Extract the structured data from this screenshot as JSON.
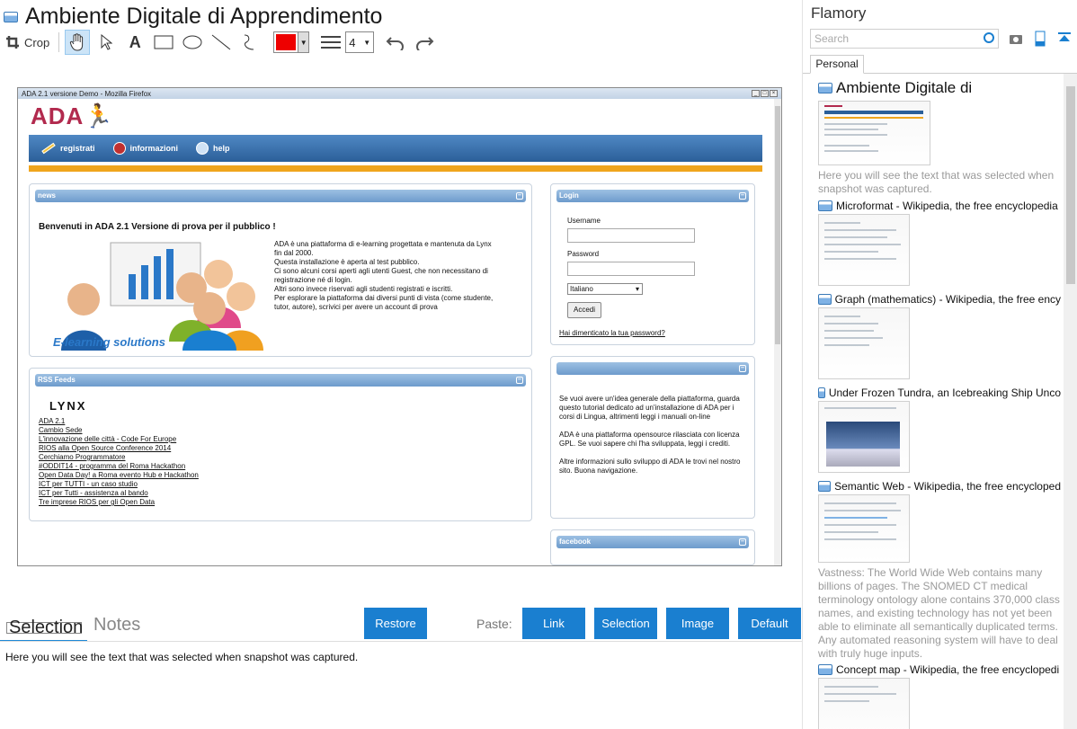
{
  "app": {
    "title": "Ambiente Digitale di Apprendimento"
  },
  "toolbar": {
    "crop_label": "Crop",
    "text_tool_glyph": "A",
    "stroke_width": "4",
    "color": "#ee0000"
  },
  "screenshot": {
    "firefox_title": "ADA 2.1 versione Demo - Mozilla Firefox",
    "logo": "ADA",
    "nav": [
      "registrati",
      "informazioni",
      "help"
    ],
    "news": {
      "header": "news",
      "heading": "Benvenuti in ADA 2.1 Versione di prova per il pubblico !",
      "lines": [
        "ADA è una piattaforma di e-learning progettata e mantenuta da Lynx",
        "fin dal 2000.",
        "Questa installazione è aperta al test pubblico.",
        "Ci sono alcuni corsi aperti agli utenti Guest, che non necessitano di",
        "registrazione né di login.",
        "Altri sono invece riservati agli studenti registrati e iscritti.",
        "Per esplorare la piattaforma dai diversi punti di vista (come studente,",
        "tutor, autore), scrivici per avere un account di prova"
      ],
      "illustration_caption": "E-learning solutions"
    },
    "rss": {
      "header": "RSS Feeds",
      "logo": "LYNX",
      "items": [
        "ADA 2.1",
        "Cambio Sede",
        "L'innovazione delle città - Code For Europe",
        "RIOS alla Open Source Conference 2014",
        "Cerchiamo Programmatore",
        "#ODDIT14 - programma del Roma Hackathon",
        "Open Data Day! a Roma evento Hub e Hackathon",
        "ICT per TUTTI - un caso studio",
        "ICT per Tutti - assistenza al bando",
        "Tre imprese RIOS per gli Open Data"
      ]
    },
    "login": {
      "header": "Login",
      "username_label": "Username",
      "password_label": "Password",
      "language": "Italiano",
      "submit": "Accedi",
      "forgot": "Hai dimenticato la tua password?"
    },
    "info": {
      "paragraphs": [
        "Se vuoi avere un'idea generale della piattaforma, guarda questo tutorial dedicato ad un'installazione di ADA per i corsi di Lingua, altrimenti leggi i manuali on-line",
        "ADA è una piattaforma opensource rilasciata con licenza GPL. Se vuoi sapere chi l'ha sviluppata, leggi i crediti.",
        "Altre informazioni sullo sviluppo di ADA le trovi nel nostro sito. Buona navigazione."
      ]
    },
    "facebook": {
      "header": "facebook"
    }
  },
  "bottom": {
    "tabs": [
      "Selection",
      "Notes"
    ],
    "restore": "Restore",
    "paste_label": "Paste:",
    "paste_buttons": [
      "Link",
      "Selection",
      "Image",
      "Default"
    ],
    "selection_text": "Here you will see the text that was selected when snapshot was captured."
  },
  "sidebar": {
    "title": "Flamory",
    "search_placeholder": "Search",
    "tab": "Personal",
    "items": [
      {
        "title": "Ambiente Digitale di",
        "desc": "Here you will see the text that was selected when snapshot was captured."
      },
      {
        "title": "Microformat - Wikipedia, the free encyclopedia",
        "desc": ""
      },
      {
        "title": "Graph (mathematics) - Wikipedia, the free ency",
        "desc": ""
      },
      {
        "title": "Under Frozen Tundra, an Icebreaking Ship Unco",
        "desc": ""
      },
      {
        "title": "Semantic Web - Wikipedia, the free encycloped",
        "desc": "Vastness: The World Wide Web contains many billions of pages. The SNOMED CT medical terminology ontology alone contains 370,000 class names, and existing technology has not yet been able to eliminate all semantically duplicated terms. Any automated reasoning system will have to deal with truly huge inputs."
      },
      {
        "title": "Concept map - Wikipedia, the free encyclopedi",
        "desc": ""
      }
    ]
  }
}
